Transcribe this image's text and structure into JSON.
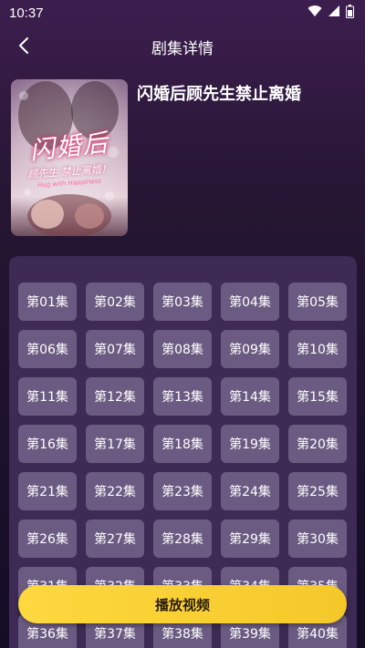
{
  "status_bar": {
    "time": "10:37"
  },
  "header": {
    "title": "剧集详情"
  },
  "drama": {
    "title": "闪婚后顾先生禁止离婚",
    "poster": {
      "title": "闪婚后",
      "subtitle": "顾先生 禁止离婚！",
      "english": "Hug with Happiness"
    }
  },
  "episodes": [
    "第01集",
    "第02集",
    "第03集",
    "第04集",
    "第05集",
    "第06集",
    "第07集",
    "第08集",
    "第09集",
    "第10集",
    "第11集",
    "第12集",
    "第13集",
    "第14集",
    "第15集",
    "第16集",
    "第17集",
    "第18集",
    "第19集",
    "第20集",
    "第21集",
    "第22集",
    "第23集",
    "第24集",
    "第25集",
    "第26集",
    "第27集",
    "第28集",
    "第29集",
    "第30集",
    "第31集",
    "第32集",
    "第33集",
    "第34集",
    "第35集",
    "第36集",
    "第37集",
    "第38集",
    "第39集",
    "第40集"
  ],
  "play_button": {
    "label": "播放视频"
  },
  "colors": {
    "accent": "#fdd83f",
    "panel": "#3d2a55",
    "episode_button": "#6b5b82"
  },
  "icons": {
    "back": "chevron-left-icon",
    "wifi": "wifi-icon",
    "signal": "signal-icon",
    "battery": "battery-icon"
  }
}
